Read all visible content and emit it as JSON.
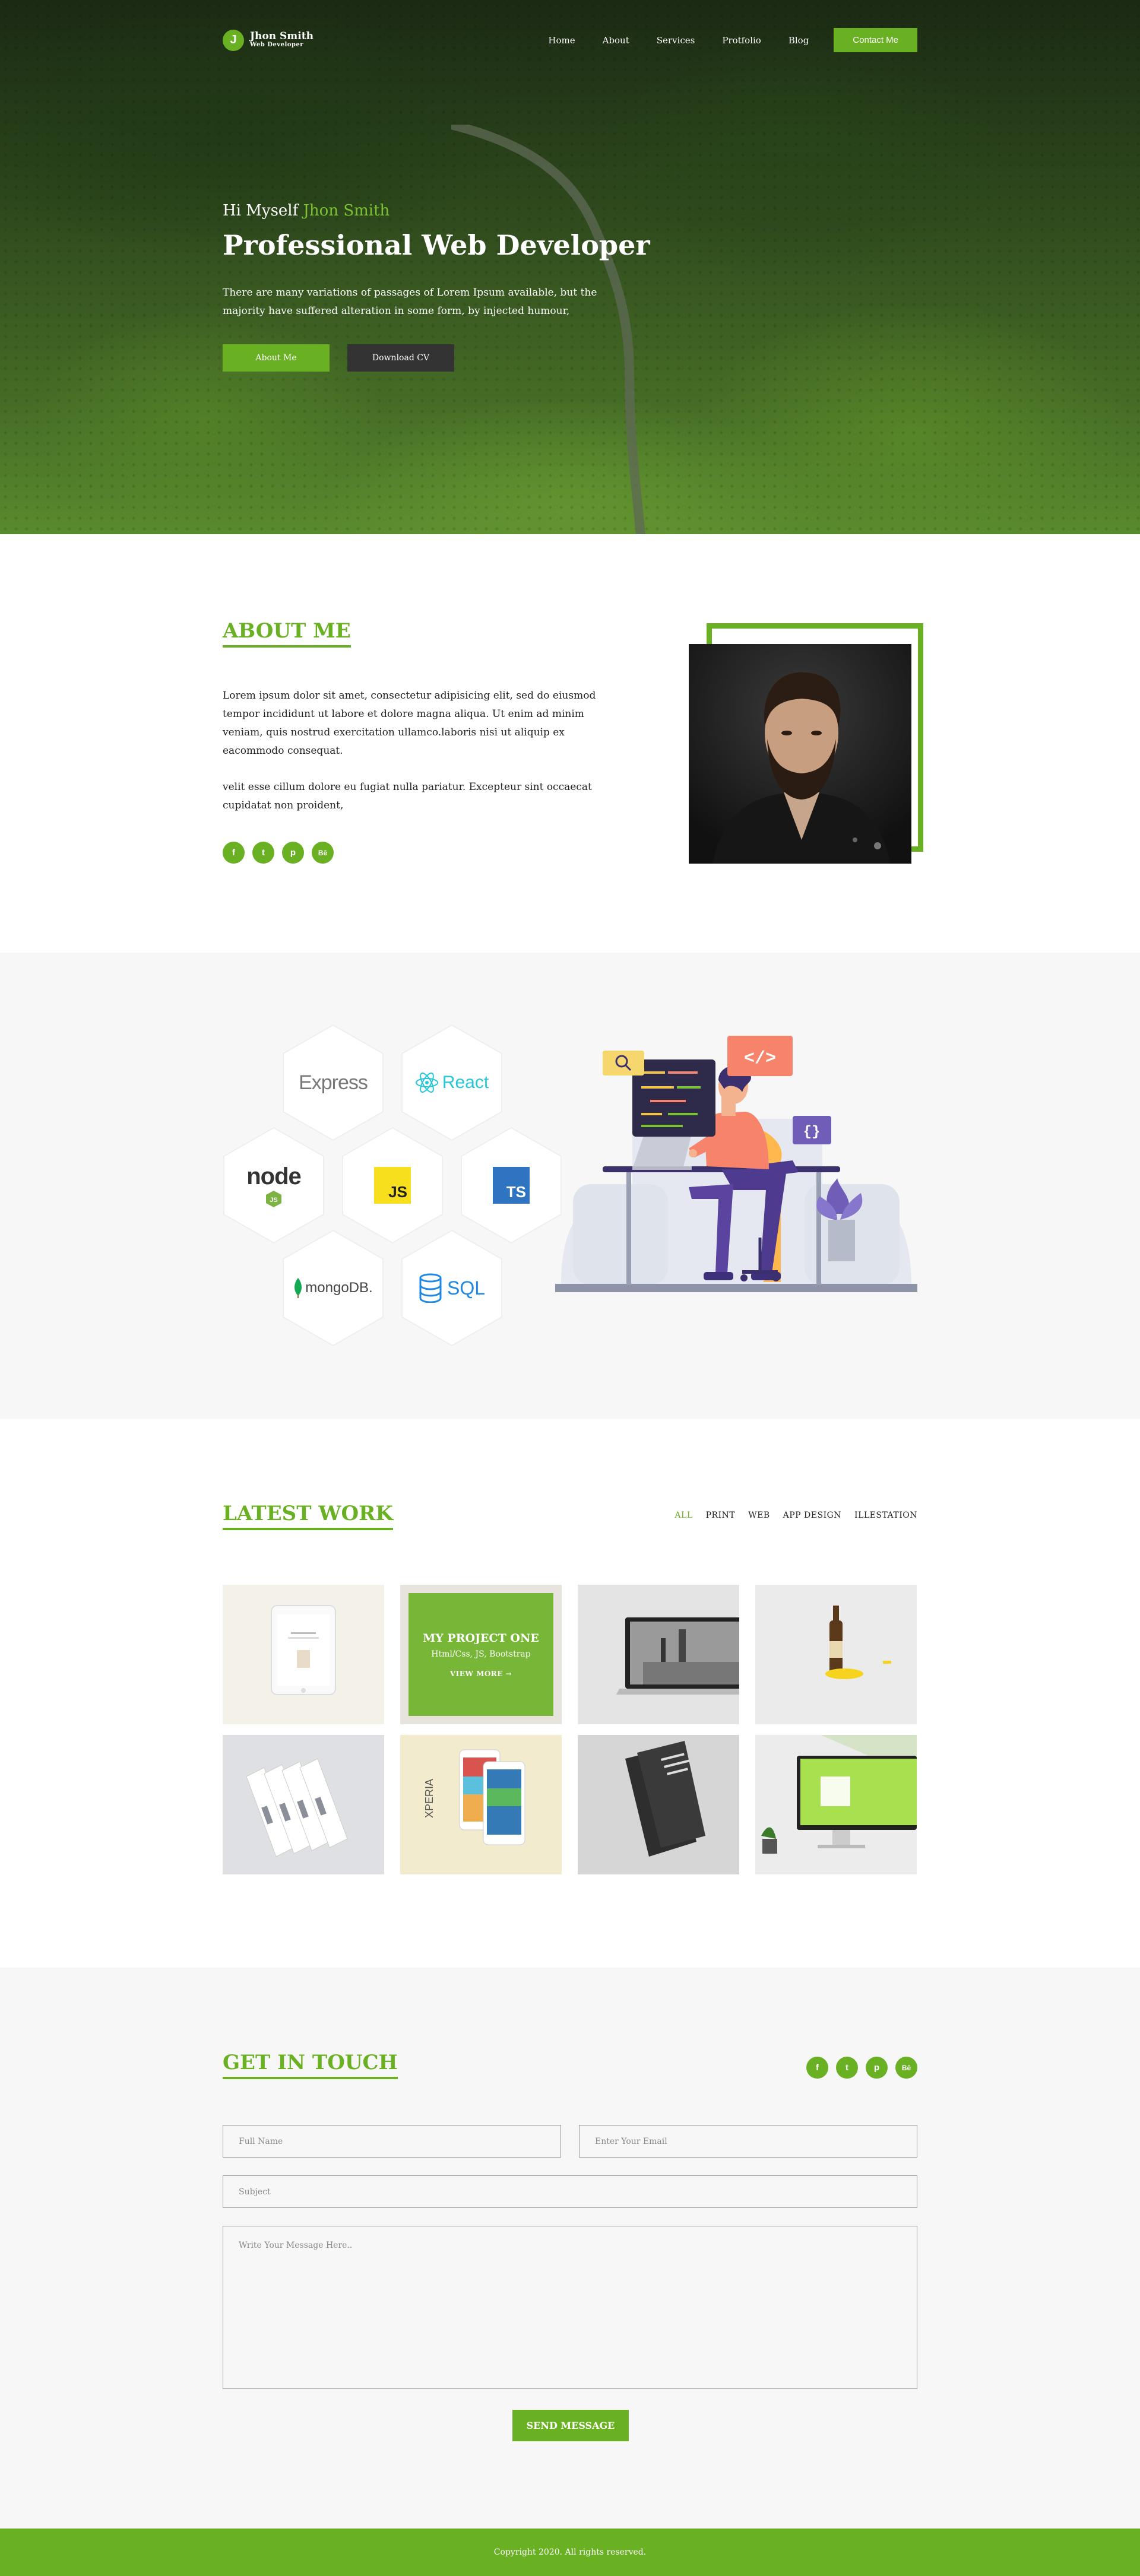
{
  "brand": {
    "initial": "J",
    "name": "Jhon Smith",
    "subtitle": "Web Developer"
  },
  "nav": {
    "items": [
      "Home",
      "About",
      "Services",
      "Protfolio",
      "Blog"
    ],
    "cta": "Contact Me"
  },
  "hero": {
    "greeting": "Hi Myself",
    "name": "Jhon Smith",
    "title": "Professional Web Developer",
    "description": "There are many variations of passages of Lorem Ipsum available, but the majority have suffered alteration in some form, by injected humour,",
    "primary_button": "About Me",
    "secondary_button": "Download CV"
  },
  "about": {
    "title": "ABOUT ME",
    "paragraph1": "Lorem ipsum dolor sit amet, consectetur adipisicing elit, sed do eiusmod tempor incididunt ut labore et dolore magna aliqua. Ut enim ad minim veniam, quis nostrud exercitation ullamco.laboris nisi ut aliquip ex eacommodo consequat.",
    "paragraph2": "velit esse cillum dolore eu fugiat nulla pariatur. Excepteur sint occaecat cupidatat non proident,"
  },
  "social": [
    {
      "icon": "facebook-icon",
      "glyph": "f"
    },
    {
      "icon": "twitter-icon",
      "glyph": "t"
    },
    {
      "icon": "pinterest-icon",
      "glyph": "p"
    },
    {
      "icon": "behance-icon",
      "glyph": "Bē"
    }
  ],
  "skills": {
    "express": "Express",
    "react": "React",
    "node": "node",
    "js": "JS",
    "ts": "TS",
    "mongodb": "mongoDB.",
    "sql": "SQL"
  },
  "work": {
    "title": "LATEST WORK",
    "filters": [
      "ALL",
      "PRINT",
      "WEB",
      "APP DESIGN",
      "ILLESTATION"
    ],
    "active_filter": "ALL",
    "featured": {
      "title": "MY PROJECT ONE",
      "subtitle": "Html/Css, JS, Bootstrap",
      "more": "VIEW MORE →"
    }
  },
  "contact": {
    "title": "GET IN TOUCH",
    "name_placeholder": "Full Name",
    "email_placeholder": "Enter Your Email",
    "subject_placeholder": "Subject",
    "message_placeholder": "Write Your Message Here..",
    "submit": "SEND MESSAGE"
  },
  "footer": {
    "copyright": "Copyright 2020. All rights reserved."
  },
  "colors": {
    "accent": "#6ab023",
    "dark_button": "#333333",
    "section_bg": "#f7f7f7"
  }
}
